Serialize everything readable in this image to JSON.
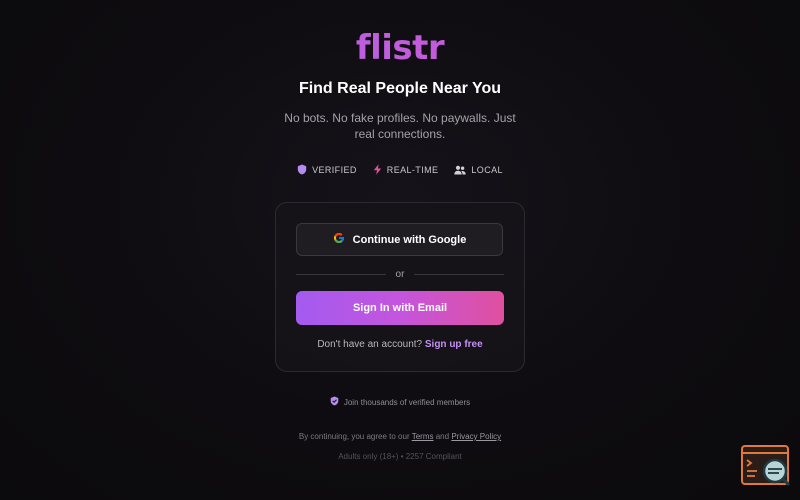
{
  "brand": {
    "logo_text": "flistr",
    "colors": {
      "logo_gradient_start": "#a66cf0",
      "logo_gradient_end": "#d858c0",
      "accent_purple": "#b86bea",
      "accent_pink": "#e0509f",
      "link": "#c48ff5",
      "background": "#0e0c10"
    }
  },
  "hero": {
    "headline": "Find Real People Near You",
    "tagline": "No bots. No fake profiles. No paywalls. Just real connections."
  },
  "features": [
    {
      "icon": "shield-icon",
      "label": "VERIFIED"
    },
    {
      "icon": "lightning-icon",
      "label": "REAL-TIME"
    },
    {
      "icon": "people-icon",
      "label": "LOCAL"
    }
  ],
  "auth": {
    "google_label": "Continue with Google",
    "divider_label": "or",
    "email_label": "Sign In with Email",
    "signup_prompt": "Don't have an account?",
    "signup_link": "Sign up free"
  },
  "footer": {
    "members_text": "Join thousands of verified members",
    "legal_prefix": "By continuing, you agree to our",
    "terms_label": "Terms",
    "legal_and": "and",
    "privacy_label": "Privacy Policy",
    "compliance_text": "Adults only (18+) • 2257 Compliant"
  },
  "widget": {
    "icon": "terminal-search-icon"
  }
}
